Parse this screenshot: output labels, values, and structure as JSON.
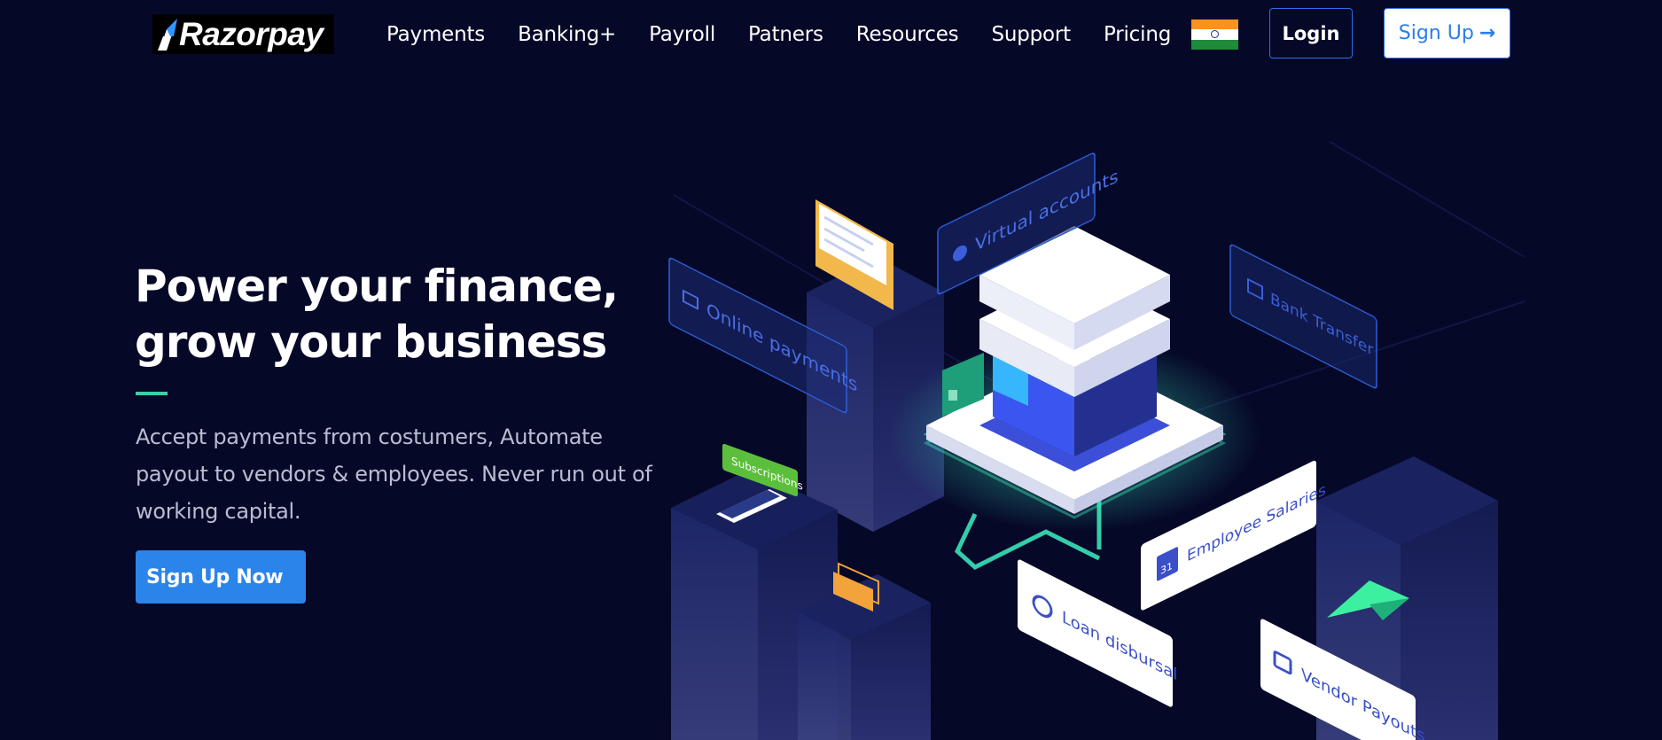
{
  "brand": {
    "logo_text": "Razorpay",
    "colors": {
      "background": "#060828",
      "accent": "#2b84ea",
      "highlight": "#38d0a5",
      "panel": "#1a2260"
    }
  },
  "nav": {
    "links": [
      "Payments",
      "Banking+",
      "Payroll",
      "Patners",
      "Resources",
      "Support",
      "Pricing"
    ],
    "country_icon": "india-flag-icon",
    "login_label": "Login",
    "signup_label": "Sign Up",
    "signup_icon": "arrow-right-icon"
  },
  "hero": {
    "title_line1": "Power your finance,",
    "title_line2": "grow your business",
    "description": "Accept payments from costumers, Automate payout to vendors & employees. Never run out of working capital.",
    "cta_label": "Sign Up Now"
  },
  "illustration": {
    "labels": {
      "virtual_accounts": "Virtual accounts",
      "online_payments": "Online payments",
      "bank_transfer": "Bank Transfer",
      "subscriptions": "Subscriptions",
      "employee_salaries": "Employee Salaries",
      "loan_disbursal": "Loan disbursal",
      "vendor_payouts": "Vendor Payouts",
      "calendar_day": "31"
    }
  }
}
